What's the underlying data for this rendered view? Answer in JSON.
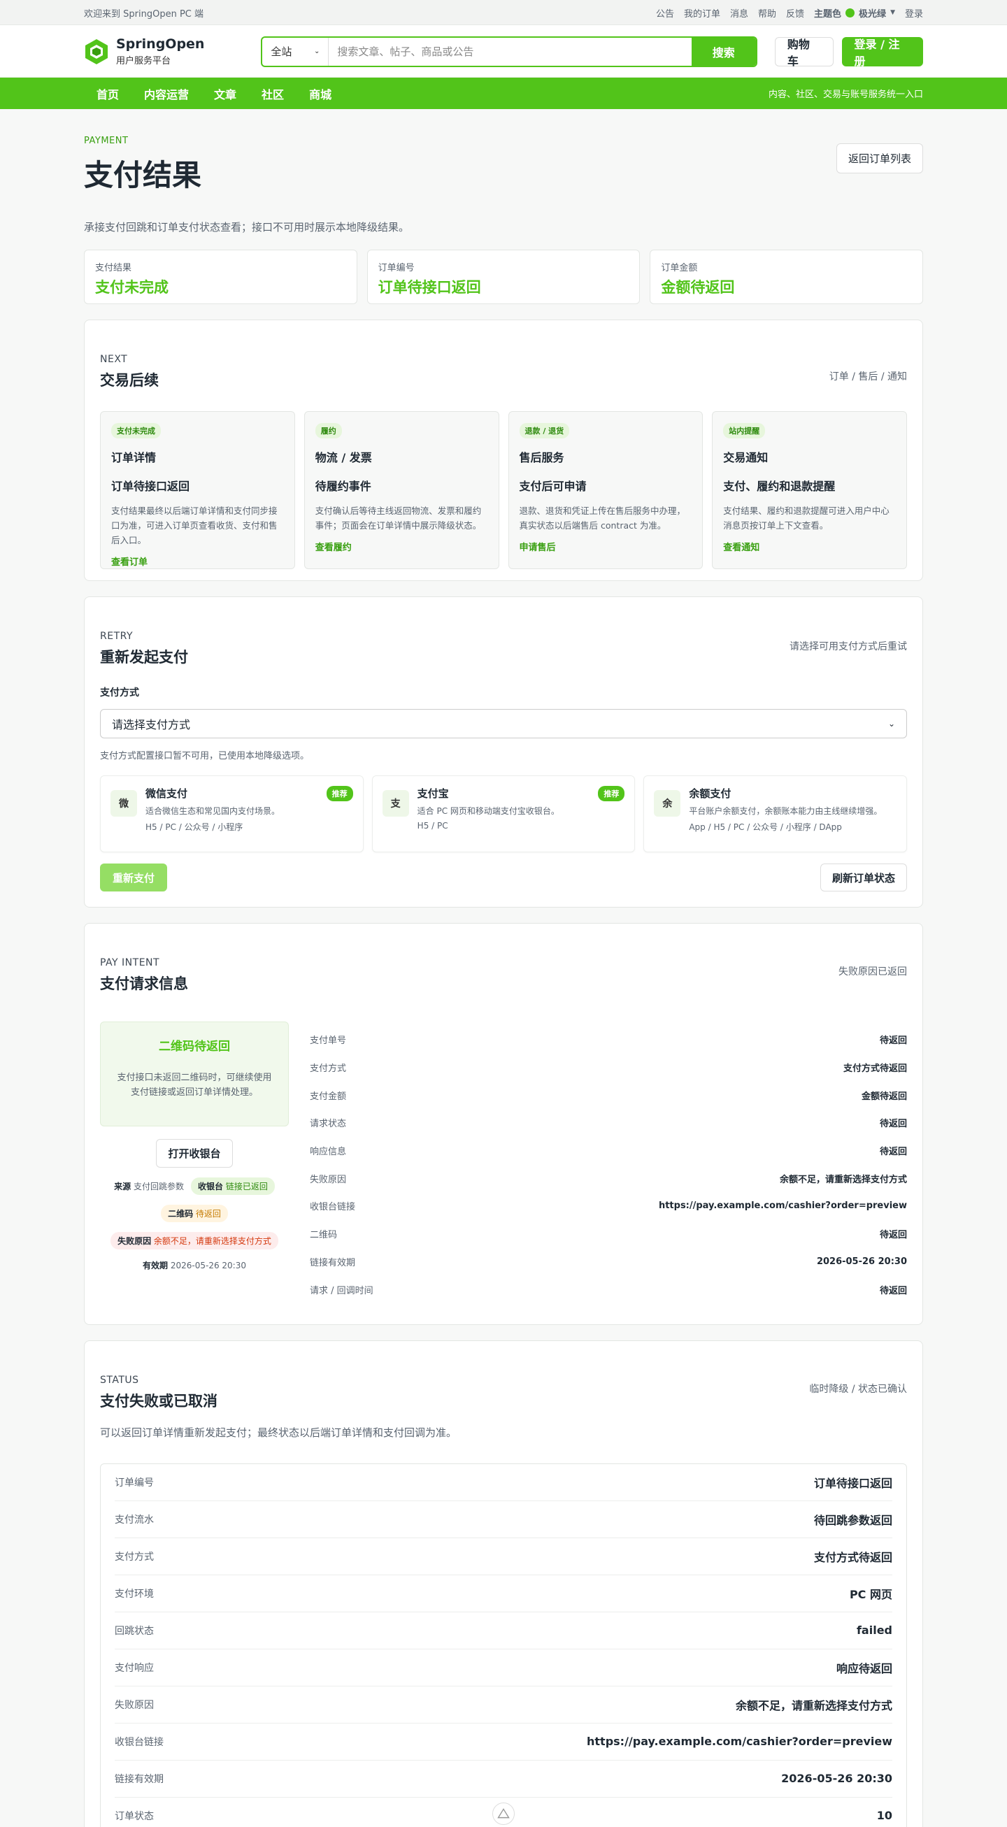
{
  "topbar": {
    "welcome": "欢迎来到 SpringOpen PC 端",
    "links": [
      "公告",
      "我的订单",
      "消息",
      "帮助",
      "反馈"
    ],
    "theme_label": "主题色",
    "theme_value": "极光绿",
    "login_link": "登录"
  },
  "header": {
    "brand": "SpringOpen",
    "subtitle": "用户服务平台",
    "search_scope": "全站",
    "search_placeholder": "搜索文章、帖子、商品或公告",
    "search_button": "搜索",
    "cart": "购物车",
    "login": "登录 / 注册"
  },
  "nav": {
    "items": [
      "首页",
      "内容运营",
      "文章",
      "社区",
      "商城"
    ],
    "right_text": "内容、社区、交易与账号服务统一入口"
  },
  "page": {
    "eyebrow": "PAYMENT",
    "title": "支付结果",
    "back_button": "返回订单列表",
    "description": "承接支付回跳和订单支付状态查看；接口不可用时展示本地降级结果。"
  },
  "stats": [
    {
      "label": "支付结果",
      "value": "支付未完成"
    },
    {
      "label": "订单编号",
      "value": "订单待接口返回"
    },
    {
      "label": "订单金额",
      "value": "金额待返回"
    }
  ],
  "next": {
    "eyebrow": "NEXT",
    "title": "交易后续",
    "right": "订单 / 售后 / 通知",
    "cards": [
      {
        "tag": "支付未完成",
        "heading": "订单详情",
        "sub": "订单待接口返回",
        "text": "支付结果最终以后端订单详情和支付同步接口为准，可进入订单页查看收货、支付和售后入口。",
        "action": "查看订单"
      },
      {
        "tag": "履约",
        "heading": "物流 / 发票",
        "sub": "待履约事件",
        "text": "支付确认后等待主线返回物流、发票和履约事件；页面会在订单详情中展示降级状态。",
        "action": "查看履约"
      },
      {
        "tag": "退款 / 退货",
        "heading": "售后服务",
        "sub": "支付后可申请",
        "text": "退款、退货和凭证上传在售后服务中办理，真实状态以后端售后 contract 为准。",
        "action": "申请售后"
      },
      {
        "tag": "站内提醒",
        "heading": "交易通知",
        "sub": "支付、履约和退款提醒",
        "text": "支付结果、履约和退款提醒可进入用户中心消息页按订单上下文查看。",
        "action": "查看通知"
      }
    ]
  },
  "retry": {
    "eyebrow": "RETRY",
    "title": "重新发起支付",
    "right": "请选择可用支付方式后重试",
    "field_label": "支付方式",
    "select_value": "请选择支付方式",
    "hint": "支付方式配置接口暂不可用，已使用本地降级选项。",
    "methods": [
      {
        "icon": "微",
        "name": "微信支付",
        "desc": "适合微信生态和常见国内支付场景。",
        "terms": "H5 / PC / 公众号 / 小程序",
        "badge": "推荐"
      },
      {
        "icon": "支",
        "name": "支付宝",
        "desc": "适合 PC 网页和移动端支付宝收银台。",
        "terms": "H5 / PC",
        "badge": "推荐"
      },
      {
        "icon": "余",
        "name": "余额支付",
        "desc": "平台账户余额支付，余额账本能力由主线继续增强。",
        "terms": "App / H5 / PC / 公众号 / 小程序 / DApp",
        "badge": ""
      }
    ],
    "retry_button": "重新支付",
    "refresh_button": "刷新订单状态"
  },
  "intent": {
    "eyebrow": "PAY INTENT",
    "title": "支付请求信息",
    "right": "失败原因已返回",
    "qr_title": "二维码待返回",
    "qr_text": "支付接口未返回二维码时，可继续使用支付链接或返回订单详情处理。",
    "open_button": "打开收银台",
    "meta": {
      "source_label": "来源",
      "source_value": "支付回跳参数",
      "cashier_label": "收银台",
      "cashier_value": "链接已返回",
      "qr_label": "二维码",
      "qr_value": "待返回",
      "fail_label": "失败原因",
      "fail_value": "余额不足，请重新选择支付方式",
      "expire_label": "有效期",
      "expire_value": "2026-05-26 20:30"
    },
    "rows": [
      {
        "k": "支付单号",
        "v": "待返回"
      },
      {
        "k": "支付方式",
        "v": "支付方式待返回"
      },
      {
        "k": "支付金额",
        "v": "金额待返回"
      },
      {
        "k": "请求状态",
        "v": "待返回"
      },
      {
        "k": "响应信息",
        "v": "待返回"
      },
      {
        "k": "失败原因",
        "v": "余额不足，请重新选择支付方式"
      },
      {
        "k": "收银台链接",
        "v": "https://pay.example.com/cashier?order=preview"
      },
      {
        "k": "二维码",
        "v": "待返回"
      },
      {
        "k": "链接有效期",
        "v": "2026-05-26 20:30"
      },
      {
        "k": "请求 / 回调时间",
        "v": "待返回"
      }
    ]
  },
  "status": {
    "eyebrow": "STATUS",
    "title": "支付失败或已取消",
    "right": "临时降级 / 状态已确认",
    "description": "可以返回订单详情重新发起支付；最终状态以后端订单详情和支付回调为准。",
    "rows": [
      {
        "k": "订单编号",
        "v": "订单待接口返回"
      },
      {
        "k": "支付流水",
        "v": "待回跳参数返回"
      },
      {
        "k": "支付方式",
        "v": "支付方式待返回"
      },
      {
        "k": "支付环境",
        "v": "PC 网页"
      },
      {
        "k": "回跳状态",
        "v": "failed"
      },
      {
        "k": "支付响应",
        "v": "响应待返回"
      },
      {
        "k": "失败原因",
        "v": "余额不足，请重新选择支付方式"
      },
      {
        "k": "收银台链接",
        "v": "https://pay.example.com/cashier?order=preview"
      },
      {
        "k": "链接有效期",
        "v": "2026-05-26 20:30"
      },
      {
        "k": "订单状态",
        "v": "10"
      }
    ]
  }
}
